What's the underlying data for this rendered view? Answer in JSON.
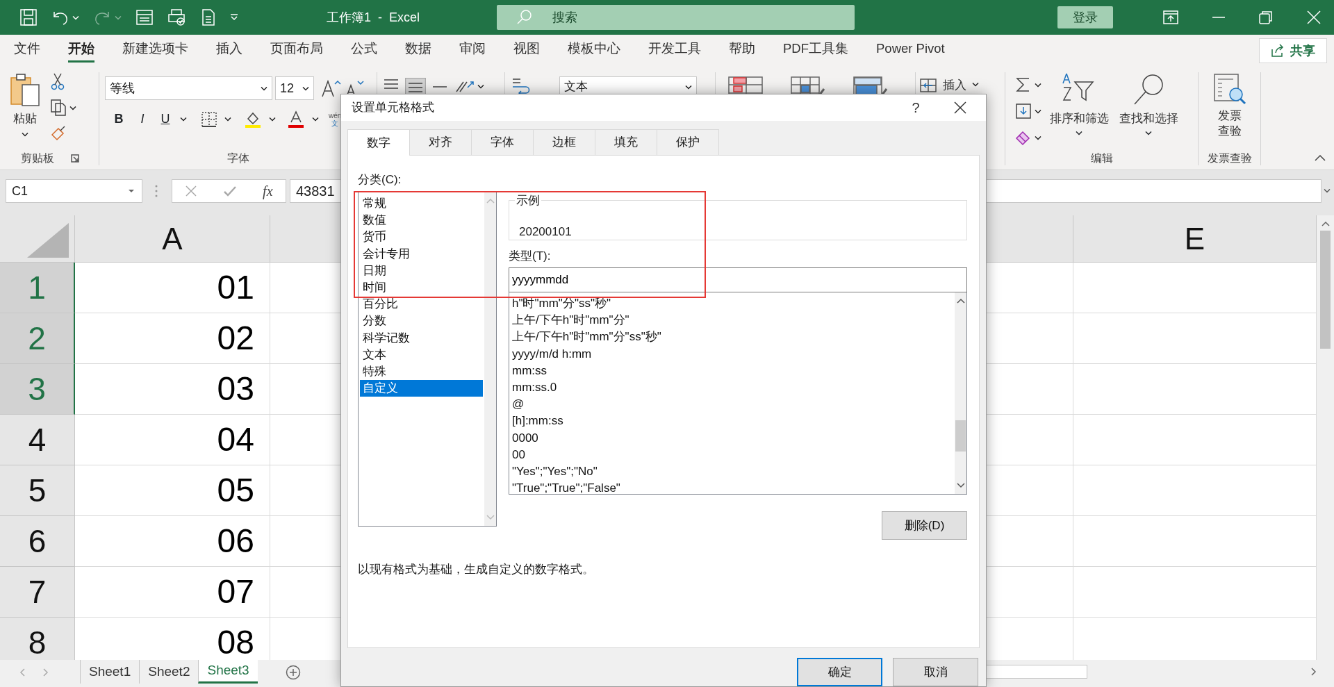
{
  "title_bar": {
    "title": "工作簿1  -  Excel",
    "search": {
      "placeholder": "搜索"
    },
    "sign_in": "登录"
  },
  "ribbon_tabs": [
    {
      "label": "文件",
      "selected": false
    },
    {
      "label": "开始",
      "selected": true
    },
    {
      "label": "新建选项卡",
      "selected": false
    },
    {
      "label": "插入",
      "selected": false
    },
    {
      "label": "页面布局",
      "selected": false
    },
    {
      "label": "公式",
      "selected": false
    },
    {
      "label": "数据",
      "selected": false
    },
    {
      "label": "审阅",
      "selected": false
    },
    {
      "label": "视图",
      "selected": false
    },
    {
      "label": "模板中心",
      "selected": false
    },
    {
      "label": "开发工具",
      "selected": false
    },
    {
      "label": "帮助",
      "selected": false
    },
    {
      "label": "PDF工具集",
      "selected": false
    },
    {
      "label": "Power Pivot",
      "selected": false
    }
  ],
  "share_button": "共享",
  "ribbon": {
    "clipboard": {
      "paste": "粘贴",
      "group_label": "剪贴板"
    },
    "font": {
      "font_name": "等线",
      "font_size": "12",
      "bold": "B",
      "italic": "I",
      "underline": "U",
      "phonetic_top": "wén",
      "phonetic_bottom": "文",
      "group_label": "字体"
    },
    "number": {
      "format": "文本"
    },
    "cells": {
      "insert": "插入"
    },
    "editing": {
      "sort_filter": "排序和筛选",
      "find_select": "查找和选择",
      "group_label": "编辑"
    },
    "invoice": {
      "check": "发票查验",
      "group_label": "发票查验"
    }
  },
  "formula_bar": {
    "name_box": "C1",
    "function_button": "fx",
    "formula": "43831"
  },
  "sheet": {
    "columns": [
      "A",
      "E"
    ],
    "rows": [
      {
        "header": "1",
        "highlighted": true,
        "column_a": "01"
      },
      {
        "header": "2",
        "highlighted": true,
        "column_a": "02"
      },
      {
        "header": "3",
        "highlighted": true,
        "column_a": "03"
      },
      {
        "header": "4",
        "highlighted": false,
        "column_a": "04"
      },
      {
        "header": "5",
        "highlighted": false,
        "column_a": "05"
      },
      {
        "header": "6",
        "highlighted": false,
        "column_a": "06"
      },
      {
        "header": "7",
        "highlighted": false,
        "column_a": "07"
      },
      {
        "header": "8",
        "highlighted": false,
        "column_a": "08"
      }
    ]
  },
  "sheet_tabs": [
    {
      "label": "Sheet1",
      "selected": false
    },
    {
      "label": "Sheet2",
      "selected": false
    },
    {
      "label": "Sheet3",
      "selected": true
    }
  ],
  "dialog": {
    "title": "设置单元格格式",
    "help": "?",
    "tabs": [
      {
        "label": "数字",
        "selected": true
      },
      {
        "label": "对齐",
        "selected": false
      },
      {
        "label": "字体",
        "selected": false
      },
      {
        "label": "边框",
        "selected": false
      },
      {
        "label": "填充",
        "selected": false
      },
      {
        "label": "保护",
        "selected": false
      }
    ],
    "category_label": "分类(C):",
    "categories": [
      {
        "label": "常规",
        "selected": false
      },
      {
        "label": "数值",
        "selected": false
      },
      {
        "label": "货币",
        "selected": false
      },
      {
        "label": "会计专用",
        "selected": false
      },
      {
        "label": "日期",
        "selected": false
      },
      {
        "label": "时间",
        "selected": false
      },
      {
        "label": "百分比",
        "selected": false
      },
      {
        "label": "分数",
        "selected": false
      },
      {
        "label": "科学记数",
        "selected": false
      },
      {
        "label": "文本",
        "selected": false
      },
      {
        "label": "特殊",
        "selected": false
      },
      {
        "label": "自定义",
        "selected": true
      }
    ],
    "sample_label": "示例",
    "sample": "20200101",
    "type_label": "类型(T):",
    "type_value": "yyyymmdd",
    "formats": [
      "h\"时\"mm\"分\"ss\"秒\"",
      "上午/下午h\"时\"mm\"分\"",
      "上午/下午h\"时\"mm\"分\"ss\"秒\"",
      "yyyy/m/d h:mm",
      "mm:ss",
      "mm:ss.0",
      "@",
      "[h]:mm:ss",
      "0000",
      "00",
      "\"Yes\";\"Yes\";\"No\"",
      "\"True\";\"True\";\"False\""
    ],
    "delete_button": "删除(D)",
    "description": "以现有格式为基础，生成自定义的数字格式。",
    "buttons": [
      {
        "label": "确定",
        "default": true
      },
      {
        "label": "取消",
        "default": false
      }
    ]
  }
}
